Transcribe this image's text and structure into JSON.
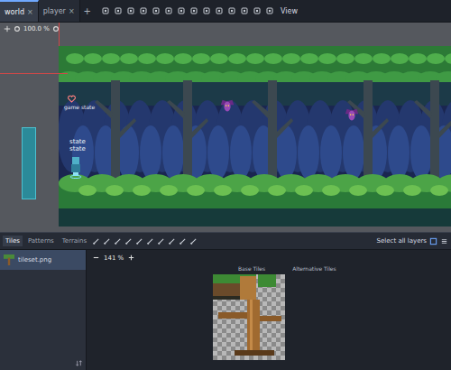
{
  "editor_tabs": [
    {
      "label": "world",
      "selected": true,
      "close": "×"
    },
    {
      "label": "player",
      "selected": false,
      "close": "×"
    }
  ],
  "add_tab": "+",
  "toolbar": {
    "menu": "View"
  },
  "viewport": {
    "zoom": "100.0 %",
    "hud_label": "game state",
    "player_labels": [
      "state",
      "state"
    ],
    "enemies": [
      {
        "kind": "bat"
      },
      {
        "kind": "bat"
      }
    ]
  },
  "bottom_panel": {
    "tabs": [
      {
        "label": "Tiles",
        "selected": true
      },
      {
        "label": "Patterns",
        "selected": false
      },
      {
        "label": "Terrains",
        "selected": false
      }
    ],
    "layers_button": "Select all layers",
    "sources": [
      {
        "label": "tileset.png",
        "selected": true
      }
    ],
    "zoom": "141 %",
    "atlas_headers": [
      "Base Tiles",
      "Alternative Tiles"
    ]
  }
}
